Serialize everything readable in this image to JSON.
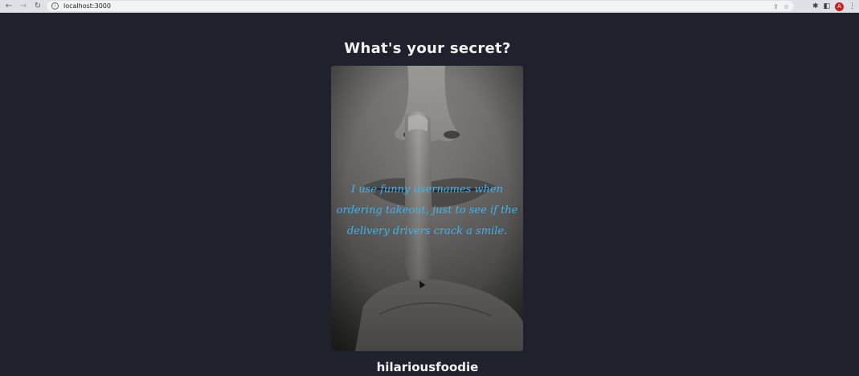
{
  "browser": {
    "url": "localhost:3000",
    "back_icon": "arrow-left",
    "forward_icon": "arrow-right",
    "reload_icon": "reload",
    "info_icon": "info",
    "share_icon": "share",
    "star_icon": "star",
    "extensions_icon": "puzzle",
    "sidepanel_icon": "side-panel",
    "avatar_initial": "A",
    "menu_icon": "kebab"
  },
  "page": {
    "title": "What's your secret?",
    "secret": "I use funny usernames when ordering takeout, just to see if the delivery drivers crack a smile.",
    "username": "hilariousfoodie",
    "accent_color": "#38b6f4",
    "background_color": "#1f212d"
  }
}
